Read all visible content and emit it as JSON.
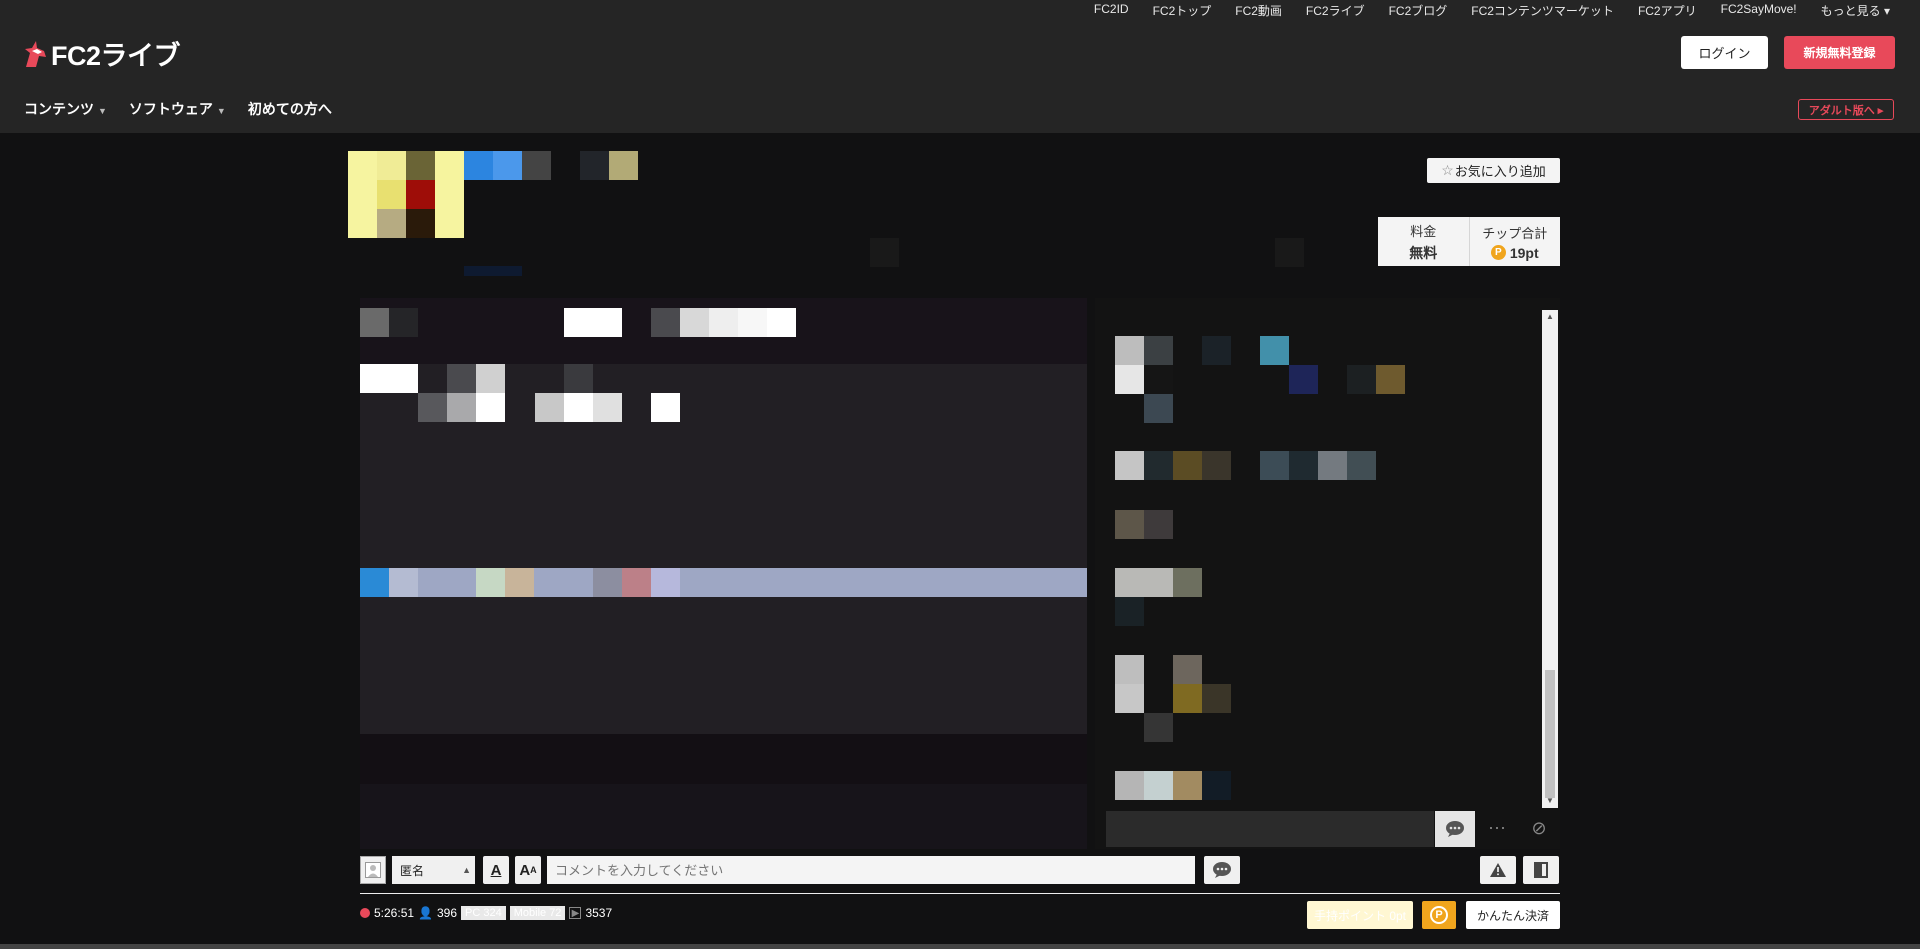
{
  "topnav": [
    "FC2ID",
    "FC2トップ",
    "FC2動画",
    "FC2ライブ",
    "FC2ブログ",
    "FC2コンテンツマーケット",
    "FC2アプリ",
    "FC2SayMove!",
    "もっと見る ▾"
  ],
  "logo": {
    "text": "FC2ライブ"
  },
  "auth": {
    "login": "ログイン",
    "register": "新規無料登録"
  },
  "mainnav": [
    {
      "label": "コンテンツ",
      "has_caret": true
    },
    {
      "label": "ソフトウェア",
      "has_caret": true
    },
    {
      "label": "初めての方へ",
      "has_caret": false
    }
  ],
  "adult_link": "アダルト版へ ▸",
  "favorite": {
    "label": "お気に入り追加",
    "icon": "star-outline-icon"
  },
  "price": {
    "fee_label": "料金",
    "fee_value": "無料",
    "tip_label": "チップ合計",
    "tip_value": "19pt"
  },
  "comment_bar": {
    "name_select": "匿名",
    "placeholder": "コメントを入力してください",
    "font_a": "A",
    "font_b": "A"
  },
  "status": {
    "time": "5:26:51",
    "viewers": "396",
    "pc": "PC 324",
    "mobile": "Mobile 72",
    "plays": "3537"
  },
  "footer_buttons": {
    "chip": "手持ポイント 0pt",
    "easy_pay": "かんたん決済"
  },
  "colors": {
    "accent": "#e8495a",
    "coin": "#f0a51d",
    "header_bg": "#252525",
    "page_bg": "#111112"
  }
}
